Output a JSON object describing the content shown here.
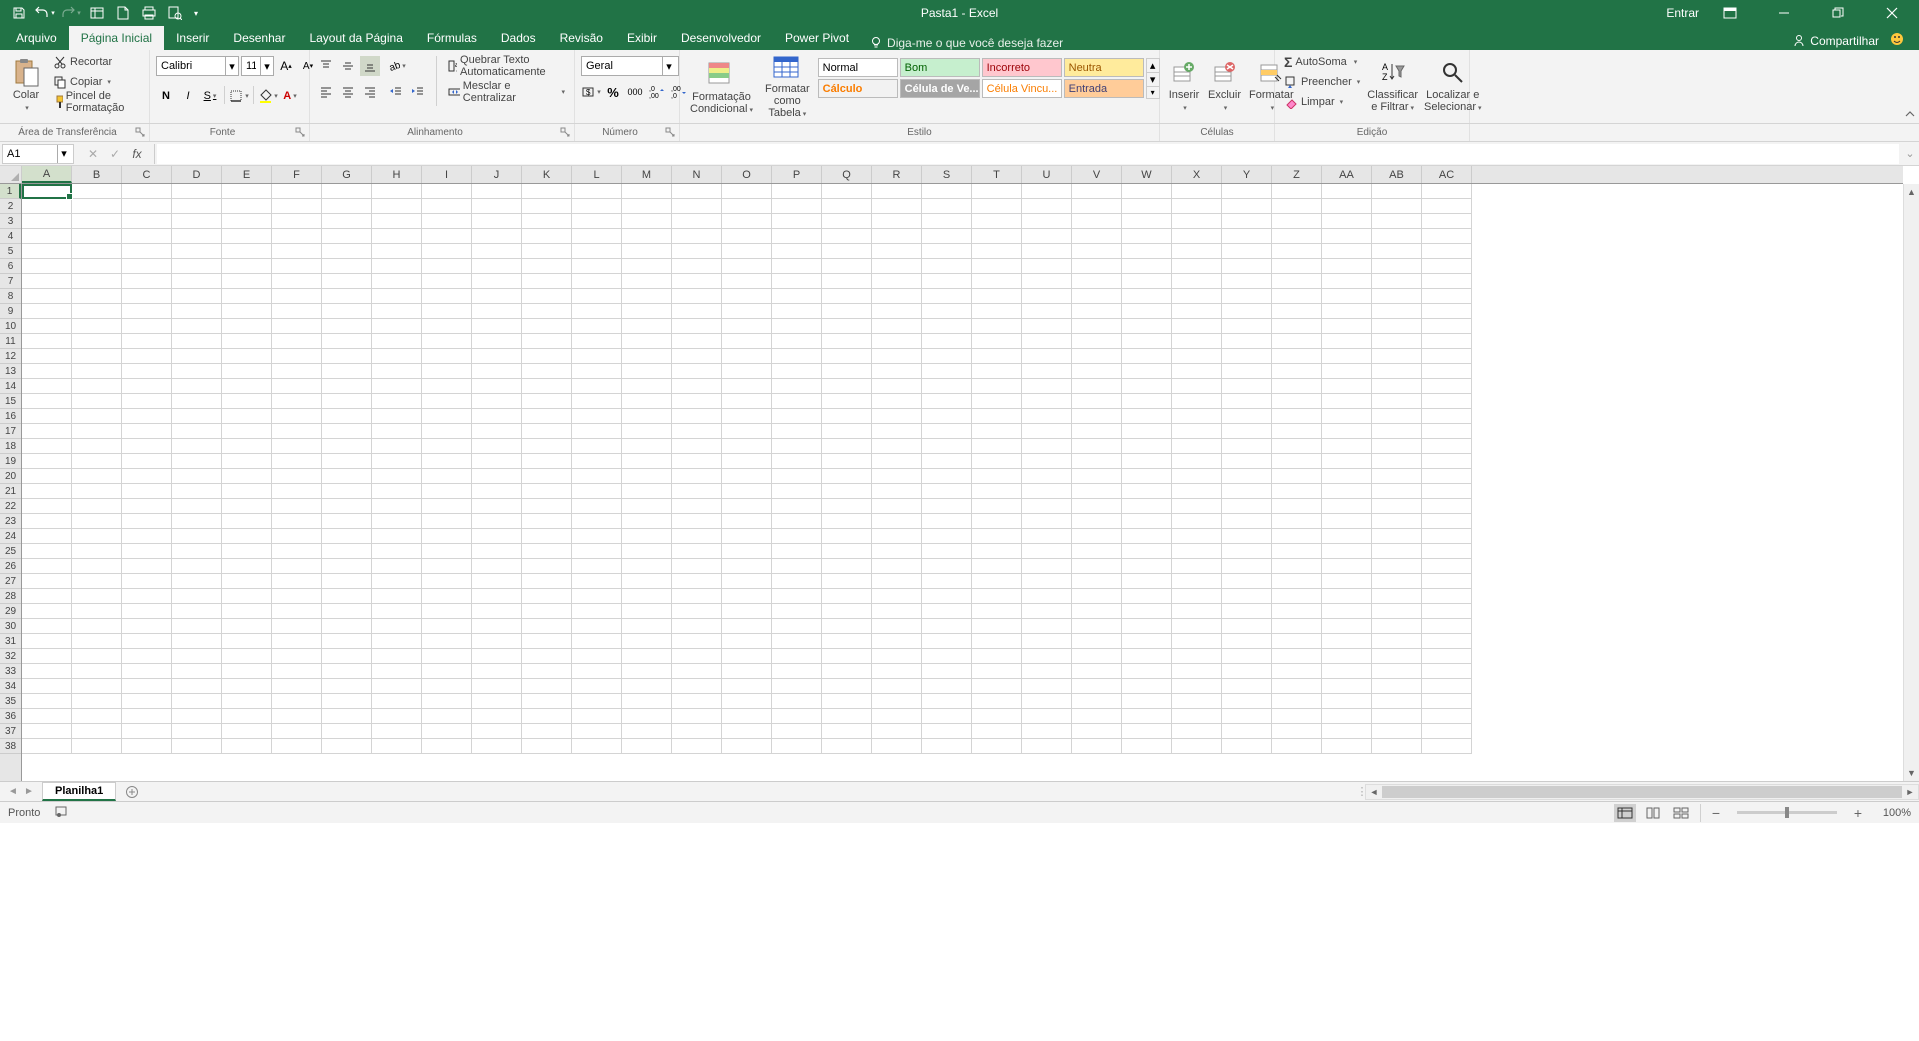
{
  "title": "Pasta1 - Excel",
  "signin": "Entrar",
  "share": "Compartilhar",
  "tabs": {
    "file": "Arquivo",
    "home": "Página Inicial",
    "insert": "Inserir",
    "draw": "Desenhar",
    "layout": "Layout da Página",
    "formulas": "Fórmulas",
    "data": "Dados",
    "review": "Revisão",
    "view": "Exibir",
    "developer": "Desenvolvedor",
    "powerpivot": "Power Pivot"
  },
  "tellme": "Diga-me o que você deseja fazer",
  "clipboard": {
    "paste": "Colar",
    "cut": "Recortar",
    "copy": "Copiar",
    "painter": "Pincel de Formatação",
    "group": "Área de Transferência"
  },
  "font": {
    "name": "Calibri",
    "size": "11",
    "bold": "N",
    "italic": "I",
    "underline": "S",
    "group": "Fonte"
  },
  "alignment": {
    "wrap": "Quebrar Texto Automaticamente",
    "merge": "Mesclar e Centralizar",
    "group": "Alinhamento"
  },
  "number": {
    "format": "Geral",
    "group": "Número"
  },
  "styles": {
    "condfmt": "Formatação Condicional",
    "table": "Formatar como Tabela",
    "normal": "Normal",
    "bom": "Bom",
    "incorreto": "Incorreto",
    "neutra": "Neutra",
    "calculo": "Cálculo",
    "celulave": "Célula de Ve...",
    "celulavinc": "Célula Vincu...",
    "entrada": "Entrada",
    "group": "Estilo"
  },
  "cells": {
    "insert": "Inserir",
    "delete": "Excluir",
    "format": "Formatar",
    "group": "Células"
  },
  "editing": {
    "autosum": "AutoSoma",
    "fill": "Preencher",
    "clear": "Limpar",
    "sortfilter": "Classificar e Filtrar",
    "findselect": "Localizar e Selecionar",
    "group": "Edição"
  },
  "namebox": "A1",
  "columns": [
    "A",
    "B",
    "C",
    "D",
    "E",
    "F",
    "G",
    "H",
    "I",
    "J",
    "K",
    "L",
    "M",
    "N",
    "O",
    "P",
    "Q",
    "R",
    "S",
    "T",
    "U",
    "V",
    "W",
    "X",
    "Y",
    "Z",
    "AA",
    "AB",
    "AC"
  ],
  "rows": 38,
  "sheet": "Planilha1",
  "status": "Pronto",
  "zoom": "100%"
}
